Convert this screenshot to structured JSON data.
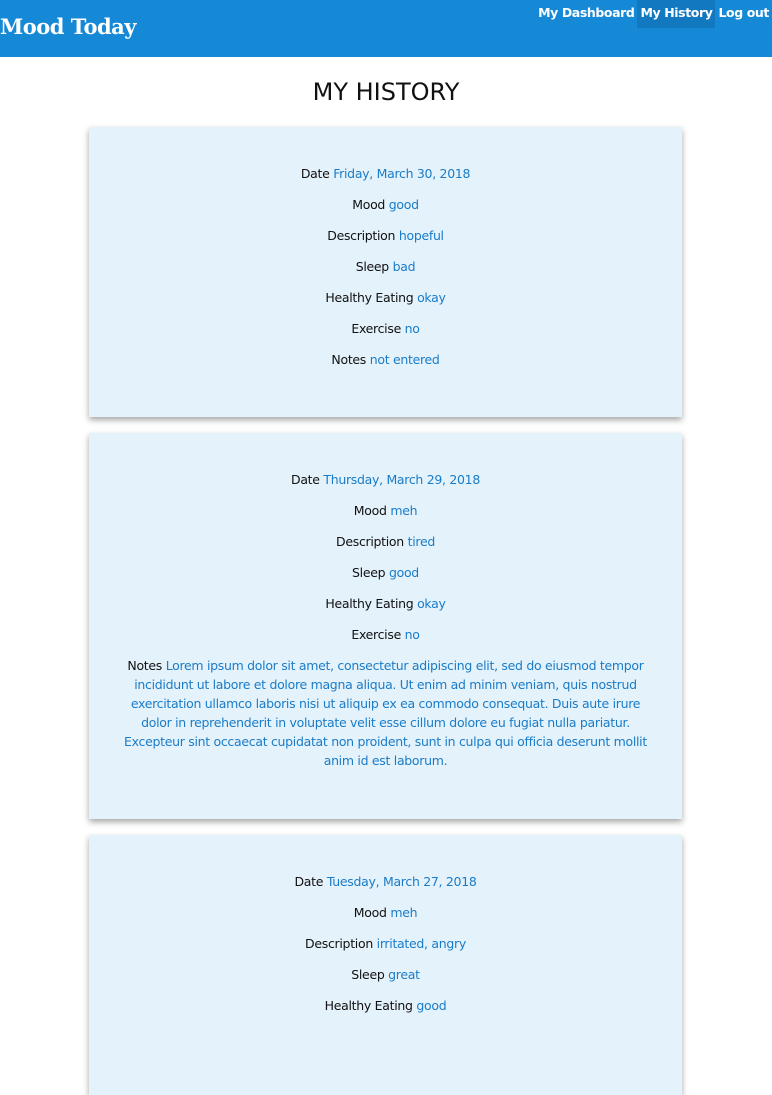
{
  "nav": {
    "brand": "Mood Today",
    "links": [
      {
        "label": "My Dashboard"
      },
      {
        "label": "My History"
      },
      {
        "label": "Log out"
      }
    ]
  },
  "page_title": "MY HISTORY",
  "field_labels": [
    "Date",
    "Mood",
    "Description",
    "Sleep",
    "Healthy Eating",
    "Exercise",
    "Notes"
  ],
  "entries": [
    {
      "values": [
        "Friday, March 30, 2018",
        "good",
        "hopeful",
        "bad",
        "okay",
        "no",
        "not entered"
      ]
    },
    {
      "values": [
        "Thursday, March 29, 2018",
        "meh",
        "tired",
        "good",
        "okay",
        "no",
        "Lorem ipsum dolor sit amet, consectetur adipiscing elit, sed do eiusmod tempor incididunt ut labore et dolore magna aliqua. Ut enim ad minim veniam, quis nostrud exercitation ullamco laboris nisi ut aliquip ex ea commodo consequat. Duis aute irure dolor in reprehenderit in voluptate velit esse cillum dolore eu fugiat nulla pariatur. Excepteur sint occaecat cupidatat non proident, sunt in culpa qui officia deserunt mollit anim id est laborum."
      ]
    },
    {
      "values": [
        "Tuesday, March 27, 2018",
        "meh",
        "irritated, angry",
        "great",
        "good"
      ]
    }
  ]
}
